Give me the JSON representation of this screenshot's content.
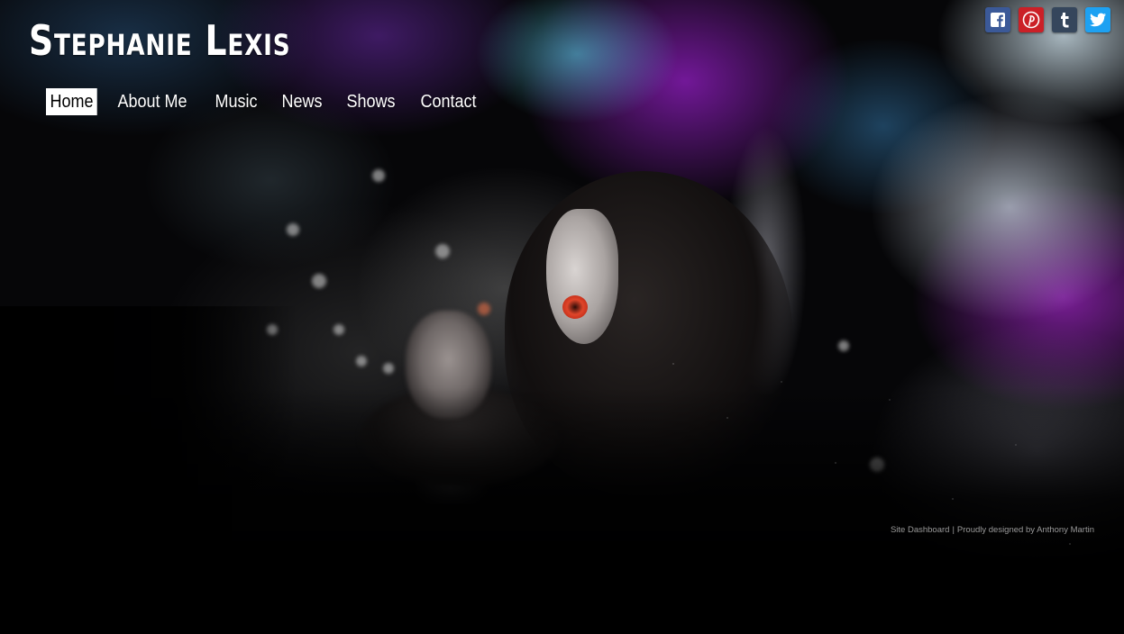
{
  "site": {
    "title": "Stephanie Lexis"
  },
  "nav": {
    "items": [
      {
        "label": "Home",
        "active": true
      },
      {
        "label": "About Me",
        "active": false
      },
      {
        "label": "Music",
        "active": false
      },
      {
        "label": "News",
        "active": false
      },
      {
        "label": "Shows",
        "active": false
      },
      {
        "label": "Contact",
        "active": false
      }
    ]
  },
  "social": {
    "icons": [
      {
        "name": "facebook-icon",
        "color": "#3b5998"
      },
      {
        "name": "pinterest-icon",
        "color": "#cb2027"
      },
      {
        "name": "tumblr-icon",
        "color": "#35465c"
      },
      {
        "name": "twitter-icon",
        "color": "#1da1f2"
      }
    ]
  },
  "footer": {
    "dashboard_link": "Site Dashboard",
    "separator": "|",
    "credit": "Proudly designed by Anthony Martin"
  },
  "colors": {
    "nav_active_bg": "#ffffff",
    "nav_text": "#ffffff",
    "footer_text": "#9a9a9a",
    "nebula_purple": "#9b2fc9",
    "nebula_cyan": "#5adcf0"
  }
}
